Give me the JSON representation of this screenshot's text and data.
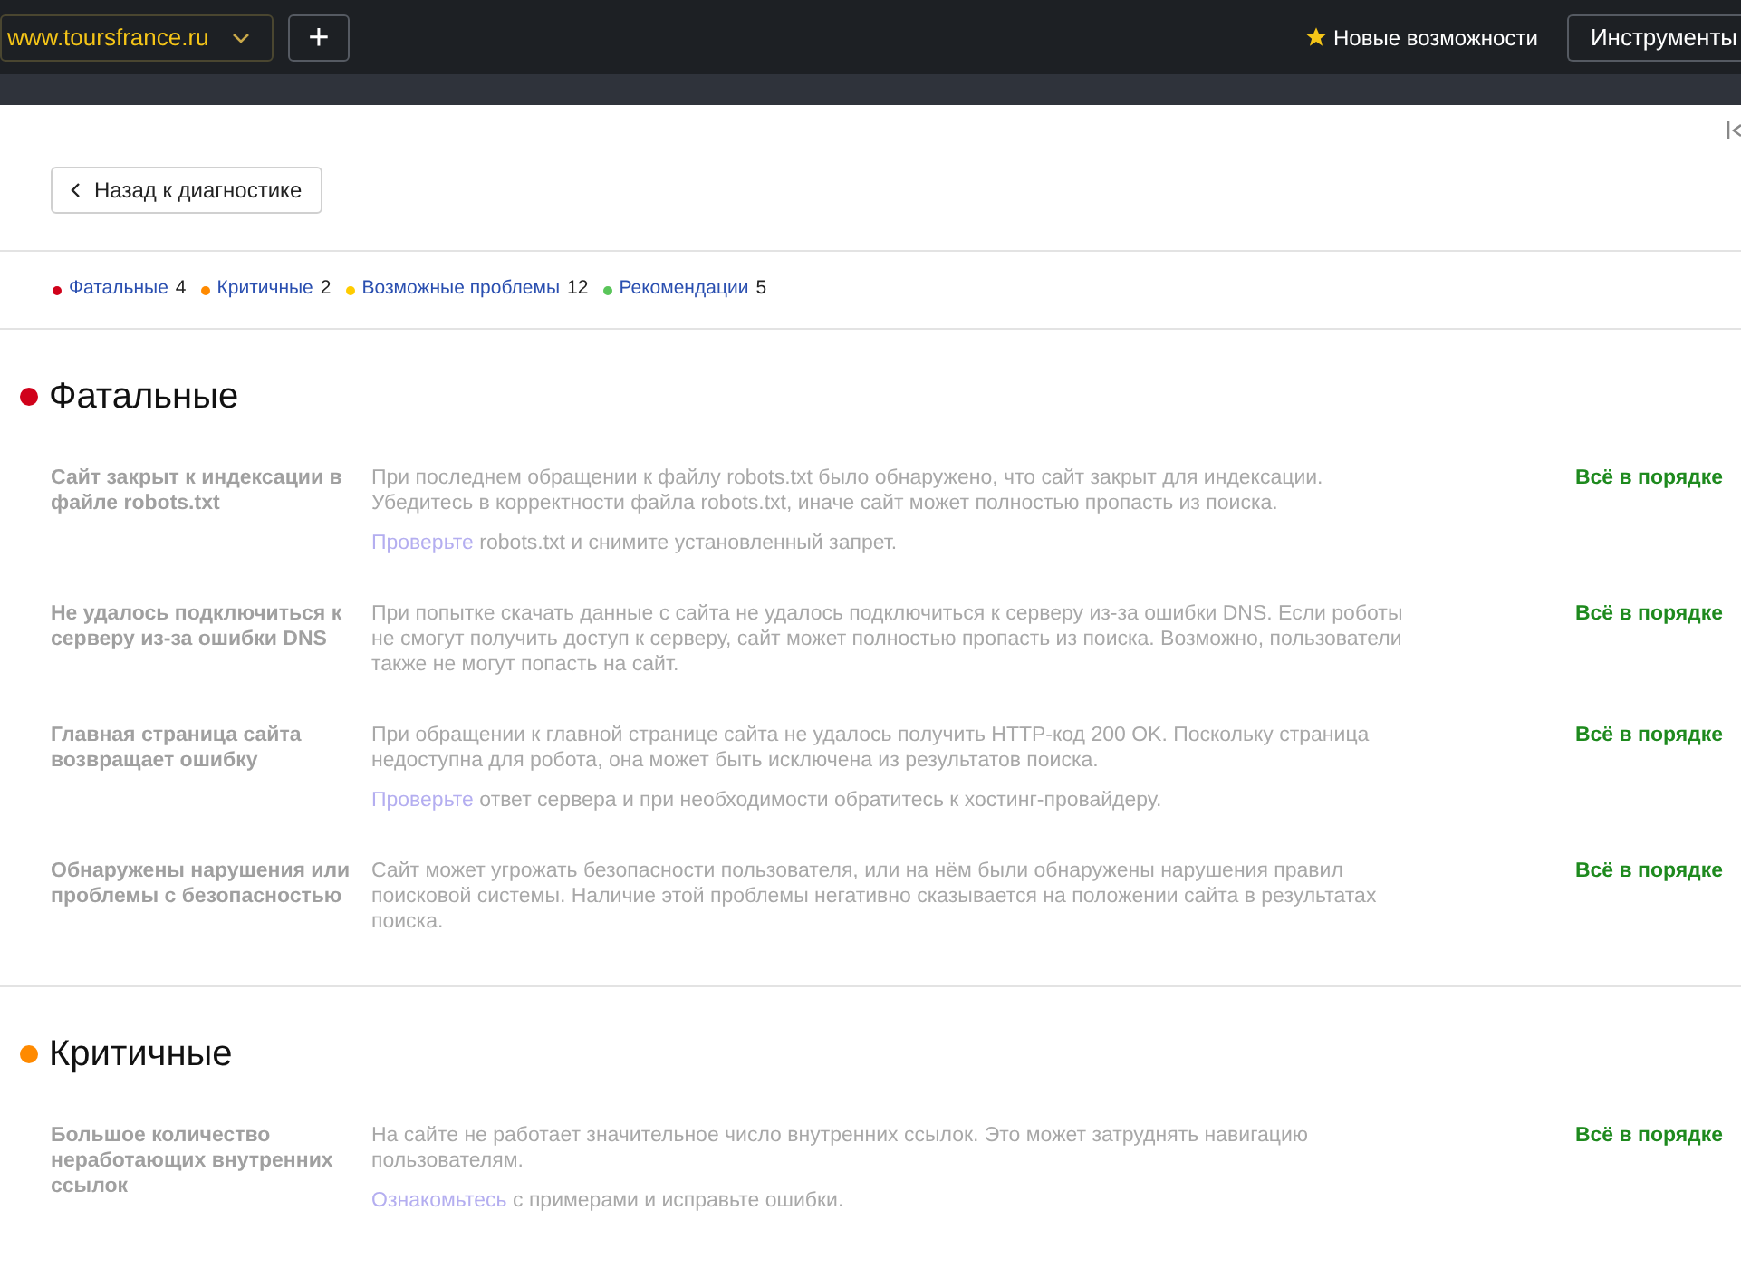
{
  "topbar": {
    "site": "www.toursfrance.ru",
    "add": "+",
    "news": "Новые возможности",
    "tools": "Инструменты"
  },
  "back_button": "Назад к диагностике",
  "summary": [
    {
      "label": "Фатальные",
      "count": "4",
      "color": "#d0021b"
    },
    {
      "label": "Критичные",
      "count": "2",
      "color": "#ff8a00"
    },
    {
      "label": "Возможные проблемы",
      "count": "12",
      "color": "#ffcc00"
    },
    {
      "label": "Рекомендации",
      "count": "5",
      "color": "#5ac55a"
    }
  ],
  "sections": [
    {
      "title": "Фатальные",
      "color": "#d0021b",
      "issues": [
        {
          "title": "Сайт закрыт к индексации в файле robots.txt",
          "description": "При последнем обращении к файлу robots.txt было обнаружено, что сайт закрыт для индексации. Убедитесь в корректности файла robots.txt, иначе сайт может полностью пропасть из поиска.",
          "hint": {
            "link": "Проверьте",
            "text": "robots.txt и снимите установленный запрет."
          },
          "status": "Всё в порядке"
        },
        {
          "title": "Не удалось подключиться к серверу из-за ошибки DNS",
          "description": "При попытке скачать данные с сайта не удалось подключиться к серверу из-за ошибки DNS. Если роботы не смогут получить доступ к серверу, сайт может полностью пропасть из поиска. Возможно, пользователи также не могут попасть на сайт.",
          "status": "Всё в порядке"
        },
        {
          "title": "Главная страница сайта возвращает ошибку",
          "description": "При обращении к главной странице сайта не удалось получить HTTP-код 200 OK. Поскольку страница недоступна для робота, она может быть исключена из результатов поиска.",
          "hint": {
            "link": "Проверьте",
            "text": "ответ сервера и при необходимости обратитесь к хостинг-провайдеру."
          },
          "status": "Всё в порядке"
        },
        {
          "title": "Обнаружены нарушения или проблемы с безопасностью",
          "description": "Сайт может угрожать безопасности пользователя, или на нём были обнаружены нарушения правил поисковой системы. Наличие этой проблемы негативно сказывается на положении сайта в результатах поиска.",
          "status": "Всё в порядке"
        }
      ]
    },
    {
      "title": "Критичные",
      "color": "#ff8a00",
      "issues": [
        {
          "title": "Большое количество неработающих внутренних ссылок",
          "description": "На сайте не работает значительное число внутренних ссылок. Это может затруднять навигацию пользователям.",
          "hint": {
            "link": "Ознакомьтесь",
            "text": "с примерами и исправьте ошибки."
          },
          "status": "Всё в порядке"
        }
      ]
    }
  ]
}
